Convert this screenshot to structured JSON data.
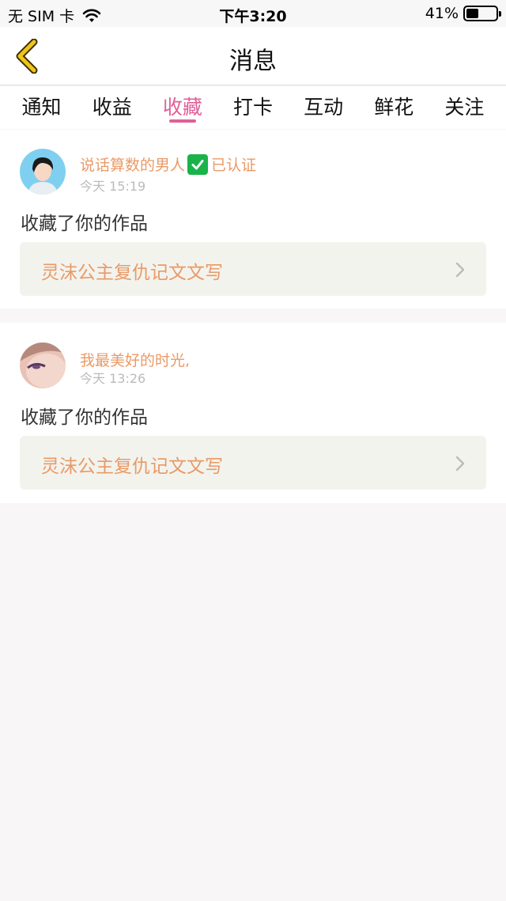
{
  "status_bar": {
    "carrier": "无 SIM 卡",
    "time": "下午3:20",
    "battery_percent": "41%",
    "battery_level": 0.41
  },
  "navbar": {
    "title": "消息",
    "back_icon": "chevron-left-icon",
    "accent_color": "#f0c419"
  },
  "tabs": [
    {
      "label": "通知",
      "active": false
    },
    {
      "label": "收益",
      "active": false
    },
    {
      "label": "收藏",
      "active": true
    },
    {
      "label": "打卡",
      "active": false
    },
    {
      "label": "互动",
      "active": false
    },
    {
      "label": "鲜花",
      "active": false
    },
    {
      "label": "关注",
      "active": false
    }
  ],
  "messages": [
    {
      "username": "说话算数的男人",
      "verified": true,
      "verified_label": "已认证",
      "time": "今天 15:19",
      "action": "收藏了你的作品",
      "work_title": "灵沫公主复仇记文文写"
    },
    {
      "username": "我最美好的时光,",
      "verified": false,
      "time": "今天 13:26",
      "action": "收藏了你的作品",
      "work_title": "灵沫公主复仇记文文写"
    }
  ],
  "colors": {
    "tab_active": "#e0609a",
    "username": "#e99a66",
    "work_box_bg": "#f3f3ee"
  }
}
